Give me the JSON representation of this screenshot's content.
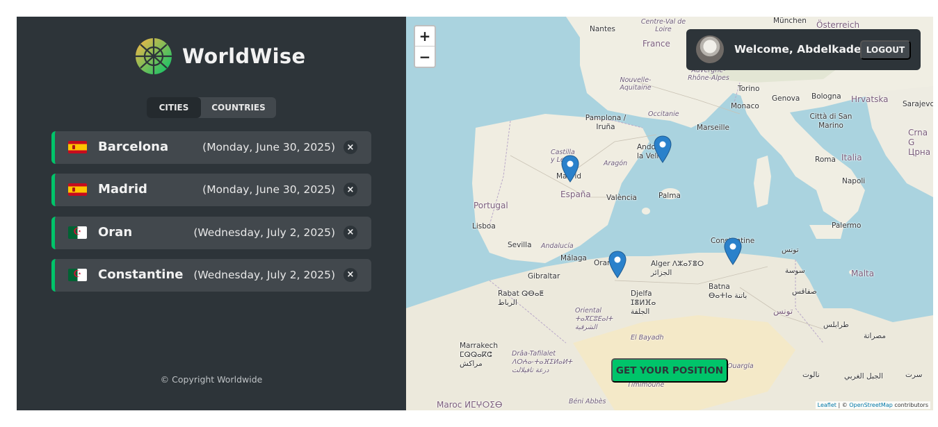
{
  "app": {
    "name": "WorldWise",
    "copyright": "© Copyright Worldwide"
  },
  "tabs": [
    {
      "label": "CITIES",
      "active": true
    },
    {
      "label": "COUNTRIES",
      "active": false
    }
  ],
  "cities": [
    {
      "name": "Barcelona",
      "date": "(Monday, June 30, 2025)",
      "flag": "spain-flag-icon"
    },
    {
      "name": "Madrid",
      "date": "(Monday, June 30, 2025)",
      "flag": "spain-flag-icon"
    },
    {
      "name": "Oran",
      "date": "(Wednesday, July 2, 2025)",
      "flag": "algeria-flag-icon"
    },
    {
      "name": "Constantine",
      "date": "(Wednesday, July 2, 2025)",
      "flag": "algeria-flag-icon"
    }
  ],
  "city_delete_label": "×",
  "user": {
    "welcome": "Welcome, Abdelkader",
    "logout_label": "LOGOUT"
  },
  "map": {
    "zoom_in": "+",
    "zoom_out": "−",
    "get_position_label": "GET YOUR POSITION",
    "attribution_leaflet": "Leaflet",
    "attribution_sep": " | © ",
    "attribution_osm": "OpenStreetMap",
    "attribution_tail": " contributors",
    "labels": {
      "nantes": "Nantes",
      "centre": "Centre-Val de Loire",
      "france": "France",
      "munchen": "München",
      "osterreich": "Österreich",
      "nouvelle": "Nouvelle-Aquitaine",
      "auvergne": "Auvergne-Rhône-Alpes",
      "torino": "Torino",
      "genova": "Genova",
      "bologna": "Bologna",
      "hrvatska": "Hrvatska",
      "sarajevo": "Sarajevc",
      "monaco": "Monaco",
      "marseille": "Marseille",
      "pamplona": "Pamplona / Iruña",
      "occitanie": "Occitanie",
      "san_marino": "Città di San Marino",
      "crna_gora": "Crna G Црна",
      "andorra": "Andorra la Vella",
      "castilla": "Castilla y León",
      "aragon": "Aragón",
      "roma": "Roma",
      "italia": "Italia",
      "madrid": "Madrid",
      "espana": "España",
      "valencia": "València",
      "napoli": "Napoli",
      "palma": "Palma",
      "portugal": "Portugal",
      "lisboa": "Lisboa",
      "palermo": "Palermo",
      "sevilla": "Sevilla",
      "andalucia": "Andalucía",
      "constantine": "Constantine",
      "tunis": "تونس",
      "malaga": "Málaga",
      "oran": "Oran",
      "alger": "Alger ⴷⵣⴰⵢⴻⵔ الجزائر",
      "gibraltar": "Gibraltar",
      "sousse": "سوسة",
      "malta": "Malta",
      "rabat": "Rabat ⵕⴱⴰⵟ الرباط",
      "batna": "Batna ⴱⴰⵜⵏⴰ باتنة",
      "sfax": "صفاقس",
      "djelfa": "Djelfa ⵊⴻⵍⴼⴰ الجلفة",
      "tunisie": "تونس",
      "oriental": "Oriental ⵜⴰⴳⵎⵓⴹⴰⵏⵜ الشرقية",
      "tarabulus": "طرابلس",
      "el_bayadh": "El Bayadh",
      "misrata": "مصراتة",
      "marrakech": "Marrakech ⵎⵕⵕⴰⴽⵛ مراكش",
      "draa": "Drâa-Tafilalet ⴷⵔⵄⴰ-ⵜⴰⴼⵉⵍⴰⵍⵜ درعة تافيلالت",
      "ouargla": "Ouargla",
      "nalut": "نالوت",
      "jabal": "الجبل الغربي",
      "sirte": "سرت",
      "timimoun": "Timimoune",
      "maroc": "Maroc ⵍⵎⵖⵔⵉⴱ",
      "beni_abbes": "Béni Abbès"
    }
  },
  "colors": {
    "sidebar_bg": "#2d3439",
    "item_bg": "#42484d",
    "accent": "#00c46a",
    "sea": "#aad3df",
    "land": "#f2efe9"
  }
}
